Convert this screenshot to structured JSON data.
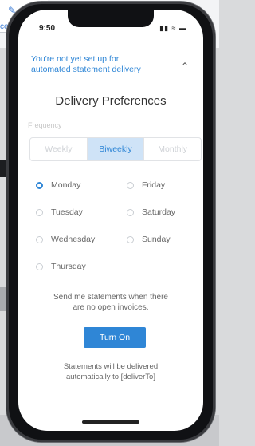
{
  "background": {
    "snippet_text": "ce"
  },
  "status_bar": {
    "time": "9:50",
    "icons": "▮▮ ≈ ▬"
  },
  "banner": {
    "line1": "You're not yet set up for",
    "line2": "automated statement delivery"
  },
  "page_title": "Delivery Preferences",
  "frequency": {
    "label": "Frequency",
    "options": [
      "Weekly",
      "Biweekly",
      "Monthly"
    ],
    "selected": "Biweekly"
  },
  "days": {
    "items": [
      {
        "label": "Monday",
        "checked": true
      },
      {
        "label": "Friday",
        "checked": false
      },
      {
        "label": "Tuesday",
        "checked": false
      },
      {
        "label": "Saturday",
        "checked": false
      },
      {
        "label": "Wednesday",
        "checked": false
      },
      {
        "label": "Sunday",
        "checked": false
      },
      {
        "label": "Thursday",
        "checked": false
      }
    ]
  },
  "no_invoices": {
    "line1": "Send me statements when there",
    "line2": "are no open invoices."
  },
  "turn_on_label": "Turn On",
  "delivery_note": {
    "line1": "Statements will be delivered",
    "line2": "automatically to [deliverTo]"
  },
  "colors": {
    "accent": "#2f86d6",
    "segment_active_bg": "#cfe3f7"
  }
}
